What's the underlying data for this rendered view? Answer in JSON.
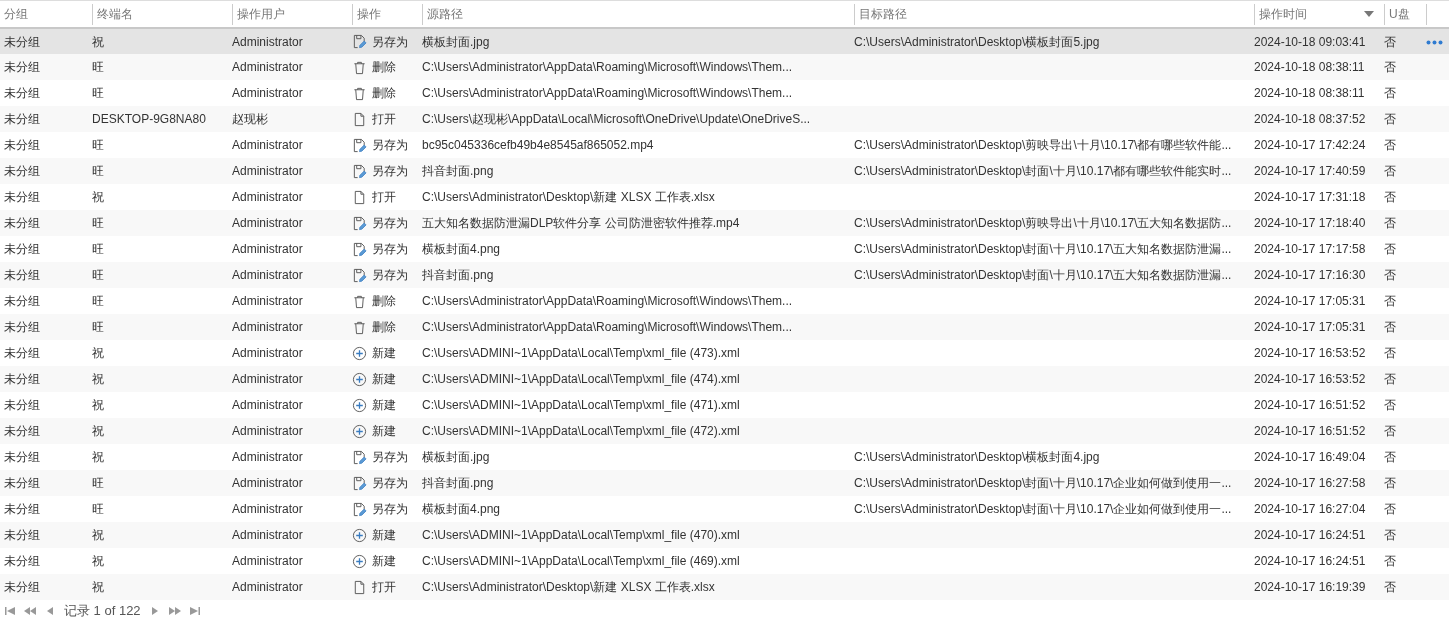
{
  "table": {
    "columns": [
      {
        "label": "分组",
        "sorted": false
      },
      {
        "label": "终端名",
        "sorted": false
      },
      {
        "label": "操作用户",
        "sorted": false
      },
      {
        "label": "操作",
        "sorted": false
      },
      {
        "label": "源路径",
        "sorted": false
      },
      {
        "label": "目标路径",
        "sorted": false
      },
      {
        "label": "操作时间",
        "sorted": true
      },
      {
        "label": "U盘",
        "sorted": false
      }
    ],
    "rows": [
      {
        "selected": true,
        "group": "未分组",
        "terminal": "祝",
        "user": "Administrator",
        "action": {
          "kind": "save_as",
          "label": "另存为"
        },
        "source": "横板封面.jpg",
        "target": "C:\\Users\\Administrator\\Desktop\\横板封面5.jpg",
        "time": "2024-10-18 09:03:41",
        "usb": "否"
      },
      {
        "selected": false,
        "group": "未分组",
        "terminal": "旺",
        "user": "Administrator",
        "action": {
          "kind": "delete",
          "label": "删除"
        },
        "source": "C:\\Users\\Administrator\\AppData\\Roaming\\Microsoft\\Windows\\Them...",
        "time": "2024-10-18 08:38:11",
        "usb": "否"
      },
      {
        "selected": false,
        "group": "未分组",
        "terminal": "旺",
        "user": "Administrator",
        "action": {
          "kind": "delete",
          "label": "删除"
        },
        "source": "C:\\Users\\Administrator\\AppData\\Roaming\\Microsoft\\Windows\\Them...",
        "time": "2024-10-18 08:38:11",
        "usb": "否"
      },
      {
        "selected": false,
        "group": "未分组",
        "terminal": "DESKTOP-9G8NA80",
        "user": "赵现彬",
        "action": {
          "kind": "open",
          "label": "打开"
        },
        "source": "C:\\Users\\赵现彬\\AppData\\Local\\Microsoft\\OneDrive\\Update\\OneDriveS...",
        "time": "2024-10-18 08:37:52",
        "usb": "否"
      },
      {
        "selected": false,
        "group": "未分组",
        "terminal": "旺",
        "user": "Administrator",
        "action": {
          "kind": "save_as",
          "label": "另存为"
        },
        "source": "bc95c045336cefb49b4e8545af865052.mp4",
        "target": "C:\\Users\\Administrator\\Desktop\\剪映导出\\十月\\10.17\\都有哪些软件能...",
        "time": "2024-10-17 17:42:24",
        "usb": "否"
      },
      {
        "selected": false,
        "group": "未分组",
        "terminal": "旺",
        "user": "Administrator",
        "action": {
          "kind": "save_as",
          "label": "另存为"
        },
        "source": "抖音封面.png",
        "target": "C:\\Users\\Administrator\\Desktop\\封面\\十月\\10.17\\都有哪些软件能实时...",
        "time": "2024-10-17 17:40:59",
        "usb": "否"
      },
      {
        "selected": false,
        "group": "未分组",
        "terminal": "祝",
        "user": "Administrator",
        "action": {
          "kind": "open",
          "label": "打开"
        },
        "source": "C:\\Users\\Administrator\\Desktop\\新建 XLSX 工作表.xlsx",
        "time": "2024-10-17 17:31:18",
        "usb": "否"
      },
      {
        "selected": false,
        "group": "未分组",
        "terminal": "旺",
        "user": "Administrator",
        "action": {
          "kind": "save_as",
          "label": "另存为"
        },
        "source": "五大知名数据防泄漏DLP软件分享 公司防泄密软件推荐.mp4",
        "target": "C:\\Users\\Administrator\\Desktop\\剪映导出\\十月\\10.17\\五大知名数据防...",
        "time": "2024-10-17 17:18:40",
        "usb": "否"
      },
      {
        "selected": false,
        "group": "未分组",
        "terminal": "旺",
        "user": "Administrator",
        "action": {
          "kind": "save_as",
          "label": "另存为"
        },
        "source": "横板封面4.png",
        "target": "C:\\Users\\Administrator\\Desktop\\封面\\十月\\10.17\\五大知名数据防泄漏...",
        "time": "2024-10-17 17:17:58",
        "usb": "否"
      },
      {
        "selected": false,
        "group": "未分组",
        "terminal": "旺",
        "user": "Administrator",
        "action": {
          "kind": "save_as",
          "label": "另存为"
        },
        "source": "抖音封面.png",
        "target": "C:\\Users\\Administrator\\Desktop\\封面\\十月\\10.17\\五大知名数据防泄漏...",
        "time": "2024-10-17 17:16:30",
        "usb": "否"
      },
      {
        "selected": false,
        "group": "未分组",
        "terminal": "旺",
        "user": "Administrator",
        "action": {
          "kind": "delete",
          "label": "删除"
        },
        "source": "C:\\Users\\Administrator\\AppData\\Roaming\\Microsoft\\Windows\\Them...",
        "time": "2024-10-17 17:05:31",
        "usb": "否"
      },
      {
        "selected": false,
        "group": "未分组",
        "terminal": "旺",
        "user": "Administrator",
        "action": {
          "kind": "delete",
          "label": "删除"
        },
        "source": "C:\\Users\\Administrator\\AppData\\Roaming\\Microsoft\\Windows\\Them...",
        "time": "2024-10-17 17:05:31",
        "usb": "否"
      },
      {
        "selected": false,
        "group": "未分组",
        "terminal": "祝",
        "user": "Administrator",
        "action": {
          "kind": "create",
          "label": "新建"
        },
        "source": "C:\\Users\\ADMINI~1\\AppData\\Local\\Temp\\xml_file (473).xml",
        "time": "2024-10-17 16:53:52",
        "usb": "否"
      },
      {
        "selected": false,
        "group": "未分组",
        "terminal": "祝",
        "user": "Administrator",
        "action": {
          "kind": "create",
          "label": "新建"
        },
        "source": "C:\\Users\\ADMINI~1\\AppData\\Local\\Temp\\xml_file (474).xml",
        "time": "2024-10-17 16:53:52",
        "usb": "否"
      },
      {
        "selected": false,
        "group": "未分组",
        "terminal": "祝",
        "user": "Administrator",
        "action": {
          "kind": "create",
          "label": "新建"
        },
        "source": "C:\\Users\\ADMINI~1\\AppData\\Local\\Temp\\xml_file (471).xml",
        "time": "2024-10-17 16:51:52",
        "usb": "否"
      },
      {
        "selected": false,
        "group": "未分组",
        "terminal": "祝",
        "user": "Administrator",
        "action": {
          "kind": "create",
          "label": "新建"
        },
        "source": "C:\\Users\\ADMINI~1\\AppData\\Local\\Temp\\xml_file (472).xml",
        "time": "2024-10-17 16:51:52",
        "usb": "否"
      },
      {
        "selected": false,
        "group": "未分组",
        "terminal": "祝",
        "user": "Administrator",
        "action": {
          "kind": "save_as",
          "label": "另存为"
        },
        "source": "横板封面.jpg",
        "target": "C:\\Users\\Administrator\\Desktop\\横板封面4.jpg",
        "time": "2024-10-17 16:49:04",
        "usb": "否"
      },
      {
        "selected": false,
        "group": "未分组",
        "terminal": "旺",
        "user": "Administrator",
        "action": {
          "kind": "save_as",
          "label": "另存为"
        },
        "source": "抖音封面.png",
        "target": "C:\\Users\\Administrator\\Desktop\\封面\\十月\\10.17\\企业如何做到使用一...",
        "time": "2024-10-17 16:27:58",
        "usb": "否"
      },
      {
        "selected": false,
        "group": "未分组",
        "terminal": "旺",
        "user": "Administrator",
        "action": {
          "kind": "save_as",
          "label": "另存为"
        },
        "source": "横板封面4.png",
        "target": "C:\\Users\\Administrator\\Desktop\\封面\\十月\\10.17\\企业如何做到使用一...",
        "time": "2024-10-17 16:27:04",
        "usb": "否"
      },
      {
        "selected": false,
        "group": "未分组",
        "terminal": "祝",
        "user": "Administrator",
        "action": {
          "kind": "create",
          "label": "新建"
        },
        "source": "C:\\Users\\ADMINI~1\\AppData\\Local\\Temp\\xml_file (470).xml",
        "time": "2024-10-17 16:24:51",
        "usb": "否"
      },
      {
        "selected": false,
        "group": "未分组",
        "terminal": "祝",
        "user": "Administrator",
        "action": {
          "kind": "create",
          "label": "新建"
        },
        "source": "C:\\Users\\ADMINI~1\\AppData\\Local\\Temp\\xml_file (469).xml",
        "time": "2024-10-17 16:24:51",
        "usb": "否"
      },
      {
        "selected": false,
        "group": "未分组",
        "terminal": "祝",
        "user": "Administrator",
        "action": {
          "kind": "open",
          "label": "打开"
        },
        "source": "C:\\Users\\Administrator\\Desktop\\新建 XLSX 工作表.xlsx",
        "time": "2024-10-17 16:19:39",
        "usb": "否"
      }
    ]
  },
  "pager": {
    "label": "记录 1 of 122"
  }
}
